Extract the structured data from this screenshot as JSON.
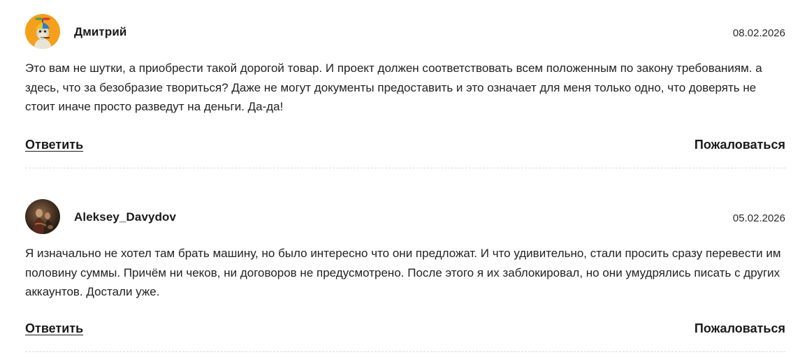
{
  "comments": [
    {
      "author": "Дмитрий",
      "avatar_icon": "propeller-hat-monkey-avatar",
      "date": "08.02.2026",
      "text": "Это вам не шутки, а приобрести такой дорогой товар. И проект должен соответствовать всем положенным по закону требованиям. а здесь, что за безобразие твориться? Даже не могут документы предоставить и это означает для меня только одно, что доверять не стоит иначе просто разведут на деньги. Да-да!",
      "reply_label": "Ответить",
      "complain_label": "Пожаловаться"
    },
    {
      "author": "Aleksey_Davydov",
      "avatar_icon": "painting-portrait-avatar",
      "date": "05.02.2026",
      "text": "Я изначально не хотел там брать машину, но было интересно что они предложат. И что удивительно, стали просить сразу перевести им половину суммы. Причём ни чеков, ни договоров не предусмотрено. После этого я их заблокировал, но они умудрялись писать с других аккаунтов. Достали уже.",
      "reply_label": "Ответить",
      "complain_label": "Пожаловаться"
    }
  ],
  "colors": {
    "text": "#222222",
    "divider": "#d9d9d9",
    "avatar1_bg": "#f4a01c",
    "avatar2_bg": "#3b2a1e"
  }
}
